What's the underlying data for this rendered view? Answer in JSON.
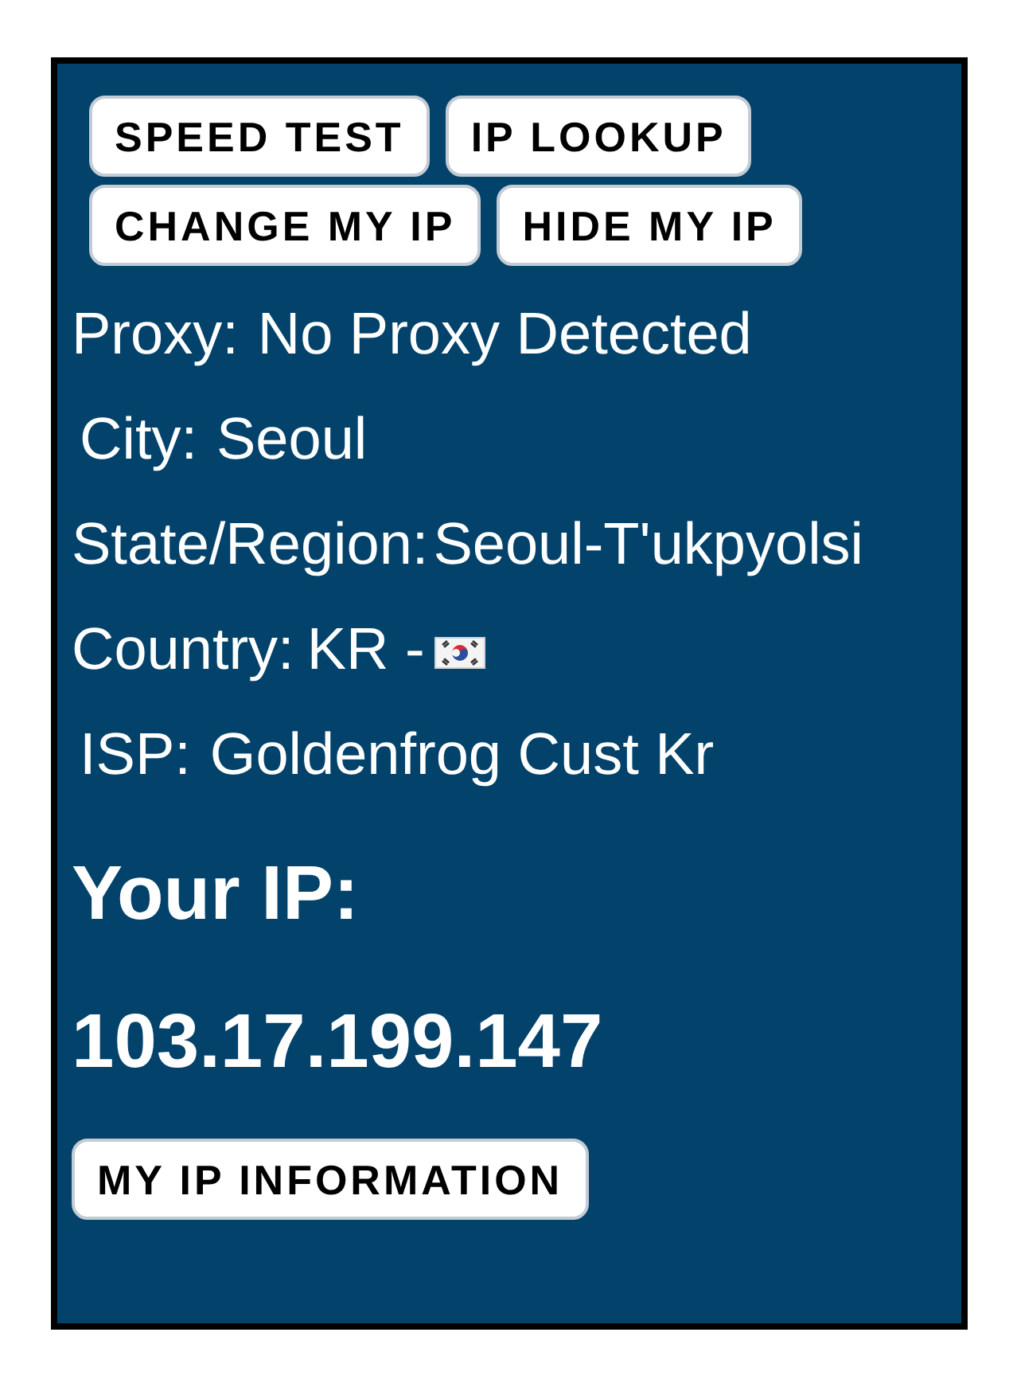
{
  "button_rows": [
    {
      "buttons": [
        "SPEED TEST",
        "IP LOOKUP"
      ]
    },
    {
      "buttons": [
        "CHANGE MY IP",
        "HIDE MY IP"
      ]
    }
  ],
  "details": [
    {
      "kind": "plain",
      "label": "Proxy:",
      "value": "No Proxy Detected"
    },
    {
      "kind": "indented",
      "label": "City:",
      "value": "Seoul"
    },
    {
      "kind": "tight",
      "label": "State/Region:",
      "value": "Seoul-T'ukpyolsi"
    },
    {
      "kind": "flag",
      "label": "Country:",
      "value": "KR -"
    },
    {
      "kind": "indented",
      "label": "ISP:",
      "value": "Goldenfrog Cust Kr"
    }
  ],
  "ip": {
    "heading": "Your IP:",
    "address": "103.17.199.147"
  },
  "info_button": "MY IP INFORMATION"
}
